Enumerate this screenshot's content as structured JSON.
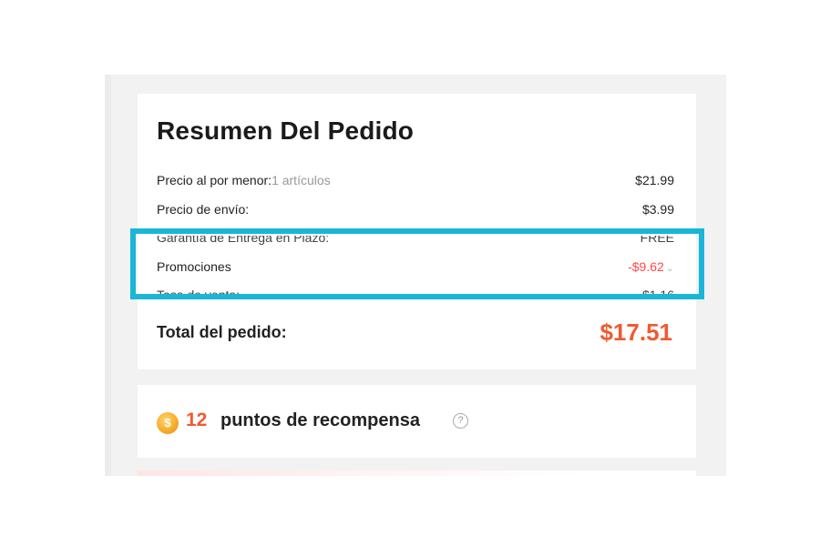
{
  "order_summary": {
    "title": "Resumen Del Pedido",
    "rows": [
      {
        "label": "Precio al por menor:",
        "sub": "1 artículos",
        "value": "$21.99"
      },
      {
        "label": "Precio de envío:",
        "value": "$3.99"
      },
      {
        "label": "Garantía de Entrega en Plazo:",
        "value": "FREE"
      },
      {
        "label": "Promociones",
        "value": "-$9.62"
      },
      {
        "label": "Tasa de venta:",
        "value": "$1.16"
      }
    ],
    "total_label": "Total del pedido:",
    "total_value": "$17.51"
  },
  "rewards": {
    "coin_symbol": "$",
    "points": "12",
    "label": "puntos de recompensa",
    "help_symbol": "?"
  },
  "icons": {
    "promo_chevron": "chevron-down-icon",
    "help": "question-circle-icon",
    "coin": "coin-icon"
  },
  "colors": {
    "accent": "#f05a30",
    "promo": "#ff4747",
    "highlight_box": "#1ab6d8"
  }
}
